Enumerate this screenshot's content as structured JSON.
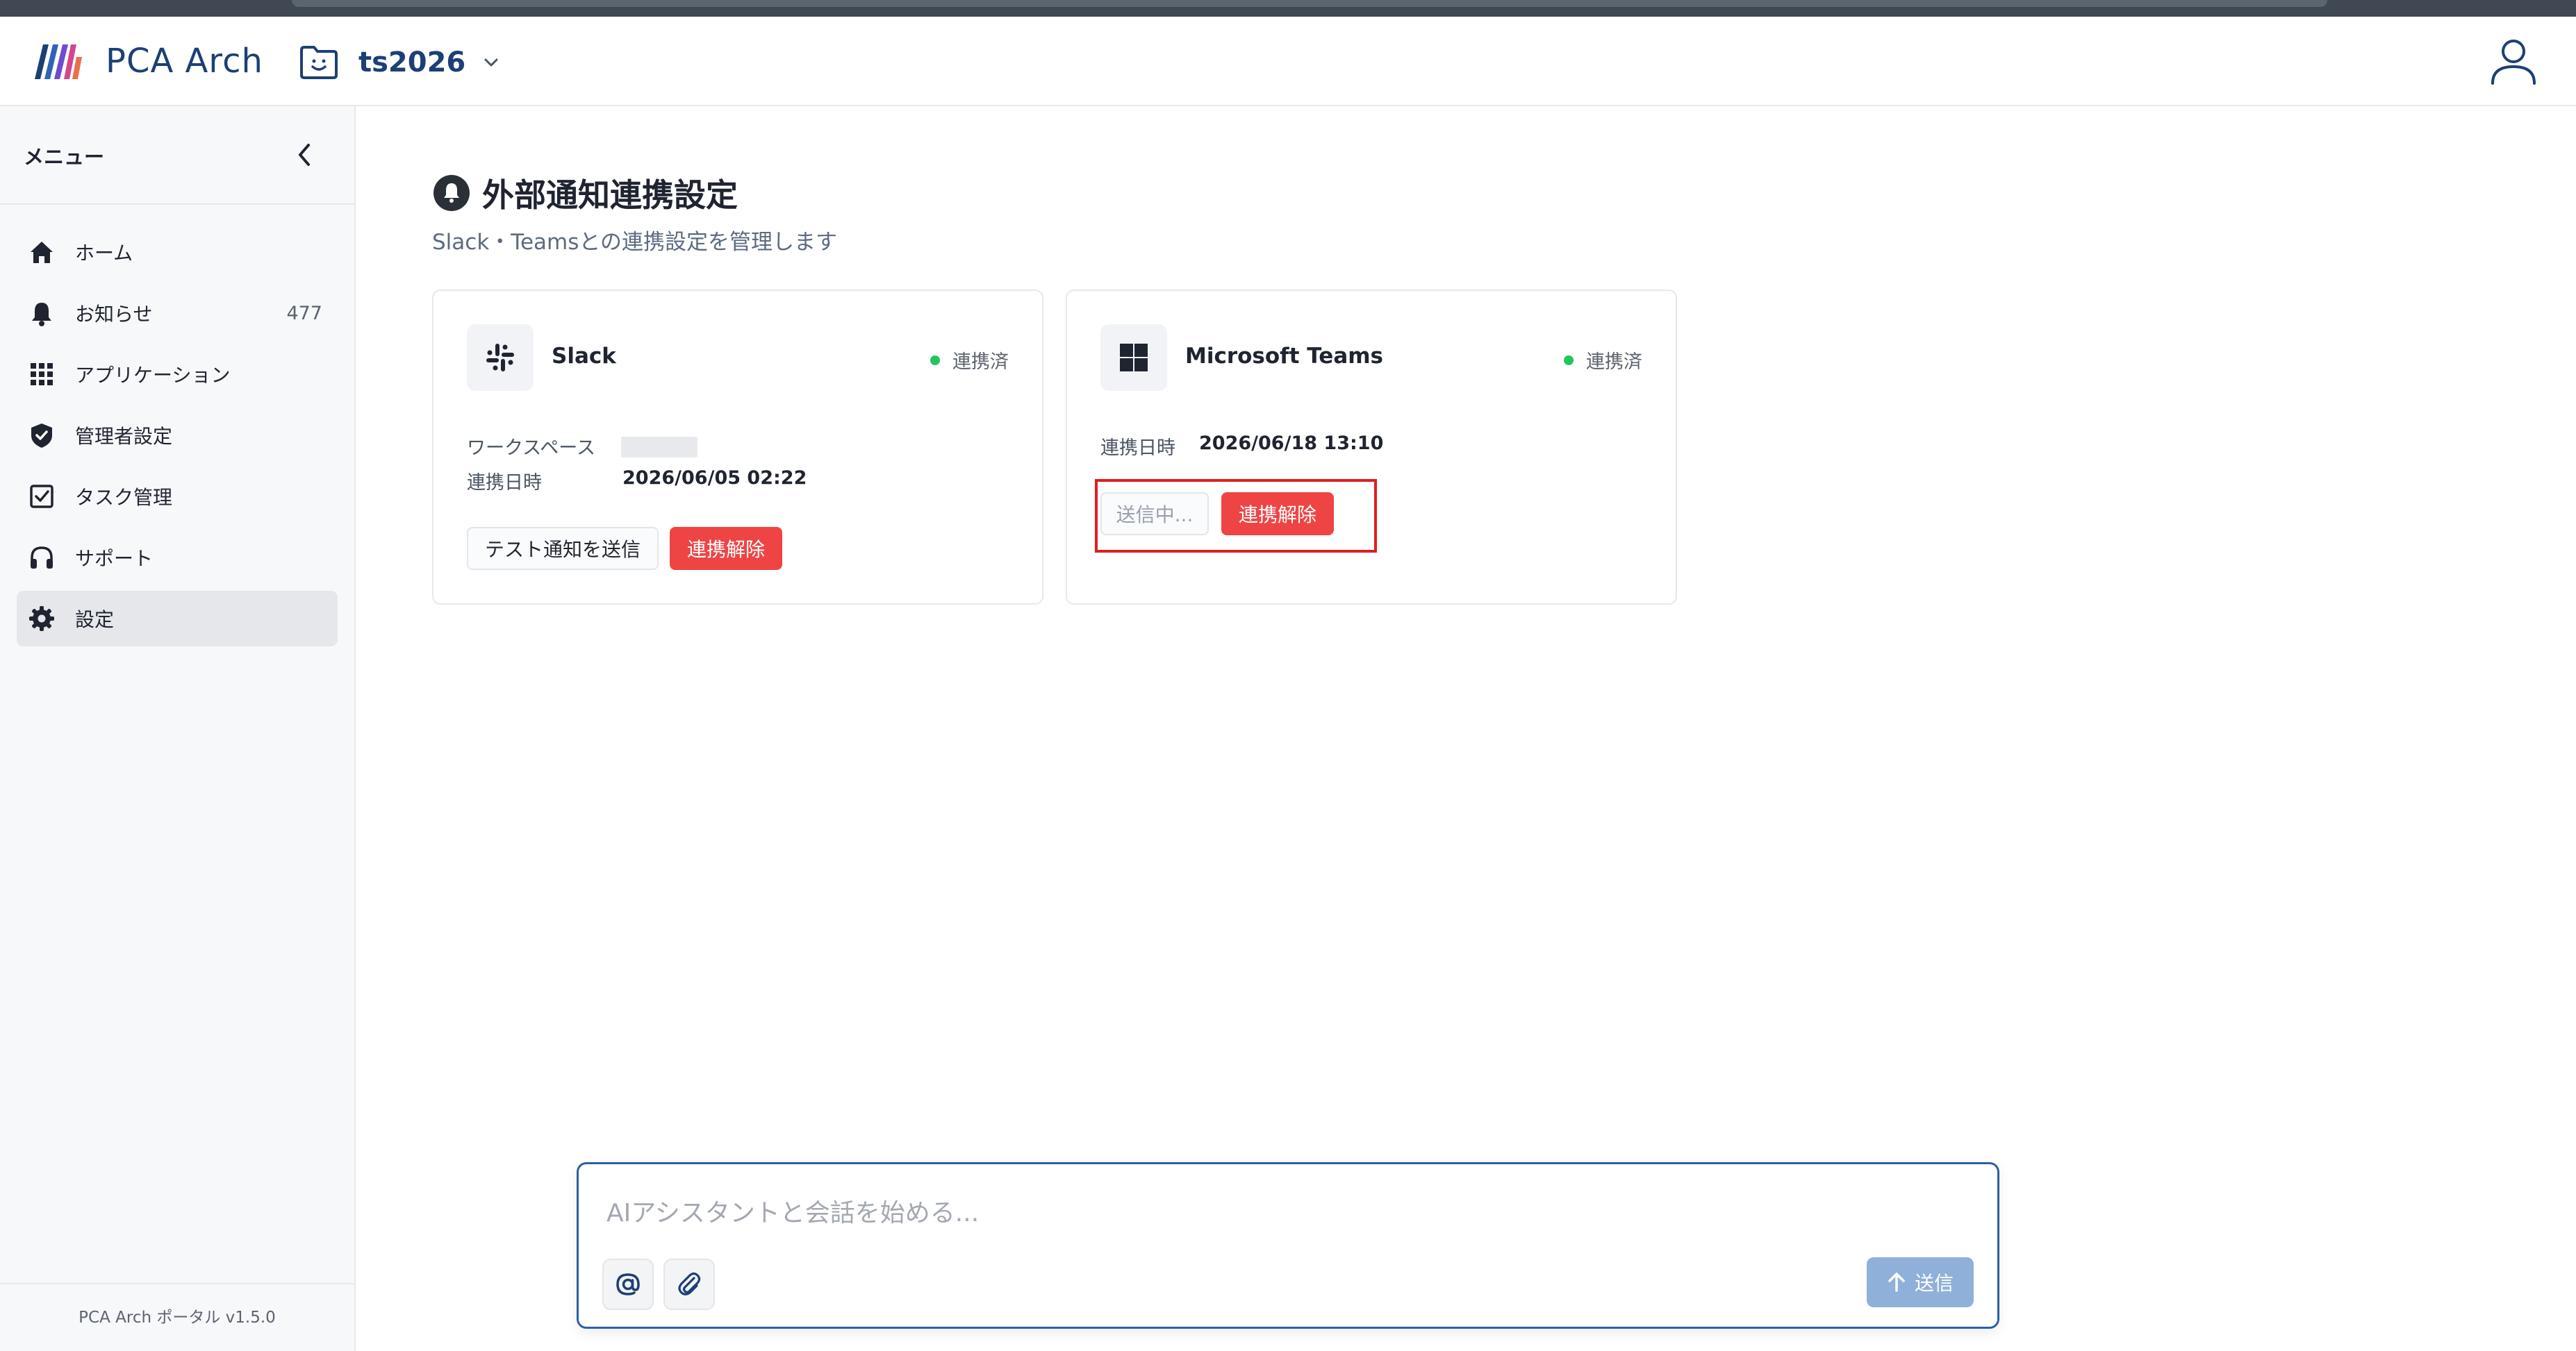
{
  "app": {
    "name": "PCA Arch"
  },
  "project": {
    "name": "ts2026"
  },
  "sidebar": {
    "title": "メニュー",
    "items": [
      {
        "label": "ホーム",
        "icon": "home-icon"
      },
      {
        "label": "お知らせ",
        "icon": "bell-icon",
        "badge": "477"
      },
      {
        "label": "アプリケーション",
        "icon": "grid-icon"
      },
      {
        "label": "管理者設定",
        "icon": "shield-icon"
      },
      {
        "label": "タスク管理",
        "icon": "checkbox-icon"
      },
      {
        "label": "サポート",
        "icon": "headphones-icon"
      },
      {
        "label": "設定",
        "icon": "gear-icon",
        "active": true
      }
    ],
    "footer": "PCA Arch ポータル v1.5.0"
  },
  "page": {
    "title": "外部通知連携設定",
    "subtitle": "Slack・Teamsとの連携設定を管理します"
  },
  "slack": {
    "name": "Slack",
    "status": "連携済",
    "workspace_label": "ワークスペース",
    "linked_label": "連携日時",
    "linked_value": "2026/06/05 02:22",
    "test_button": "テスト通知を送信",
    "disconnect_button": "連携解除"
  },
  "teams": {
    "name": "Microsoft Teams",
    "status": "連携済",
    "linked_label": "連携日時",
    "linked_value": "2026/06/18 13:10",
    "sending_button": "送信中...",
    "disconnect_button": "連携解除"
  },
  "chat": {
    "placeholder": "AIアシスタントと会話を始める...",
    "send_label": "送信"
  },
  "colors": {
    "brand": "#1d3f76",
    "danger": "#ef4444",
    "connected": "#22c55e",
    "highlight": "#e01e1e"
  }
}
